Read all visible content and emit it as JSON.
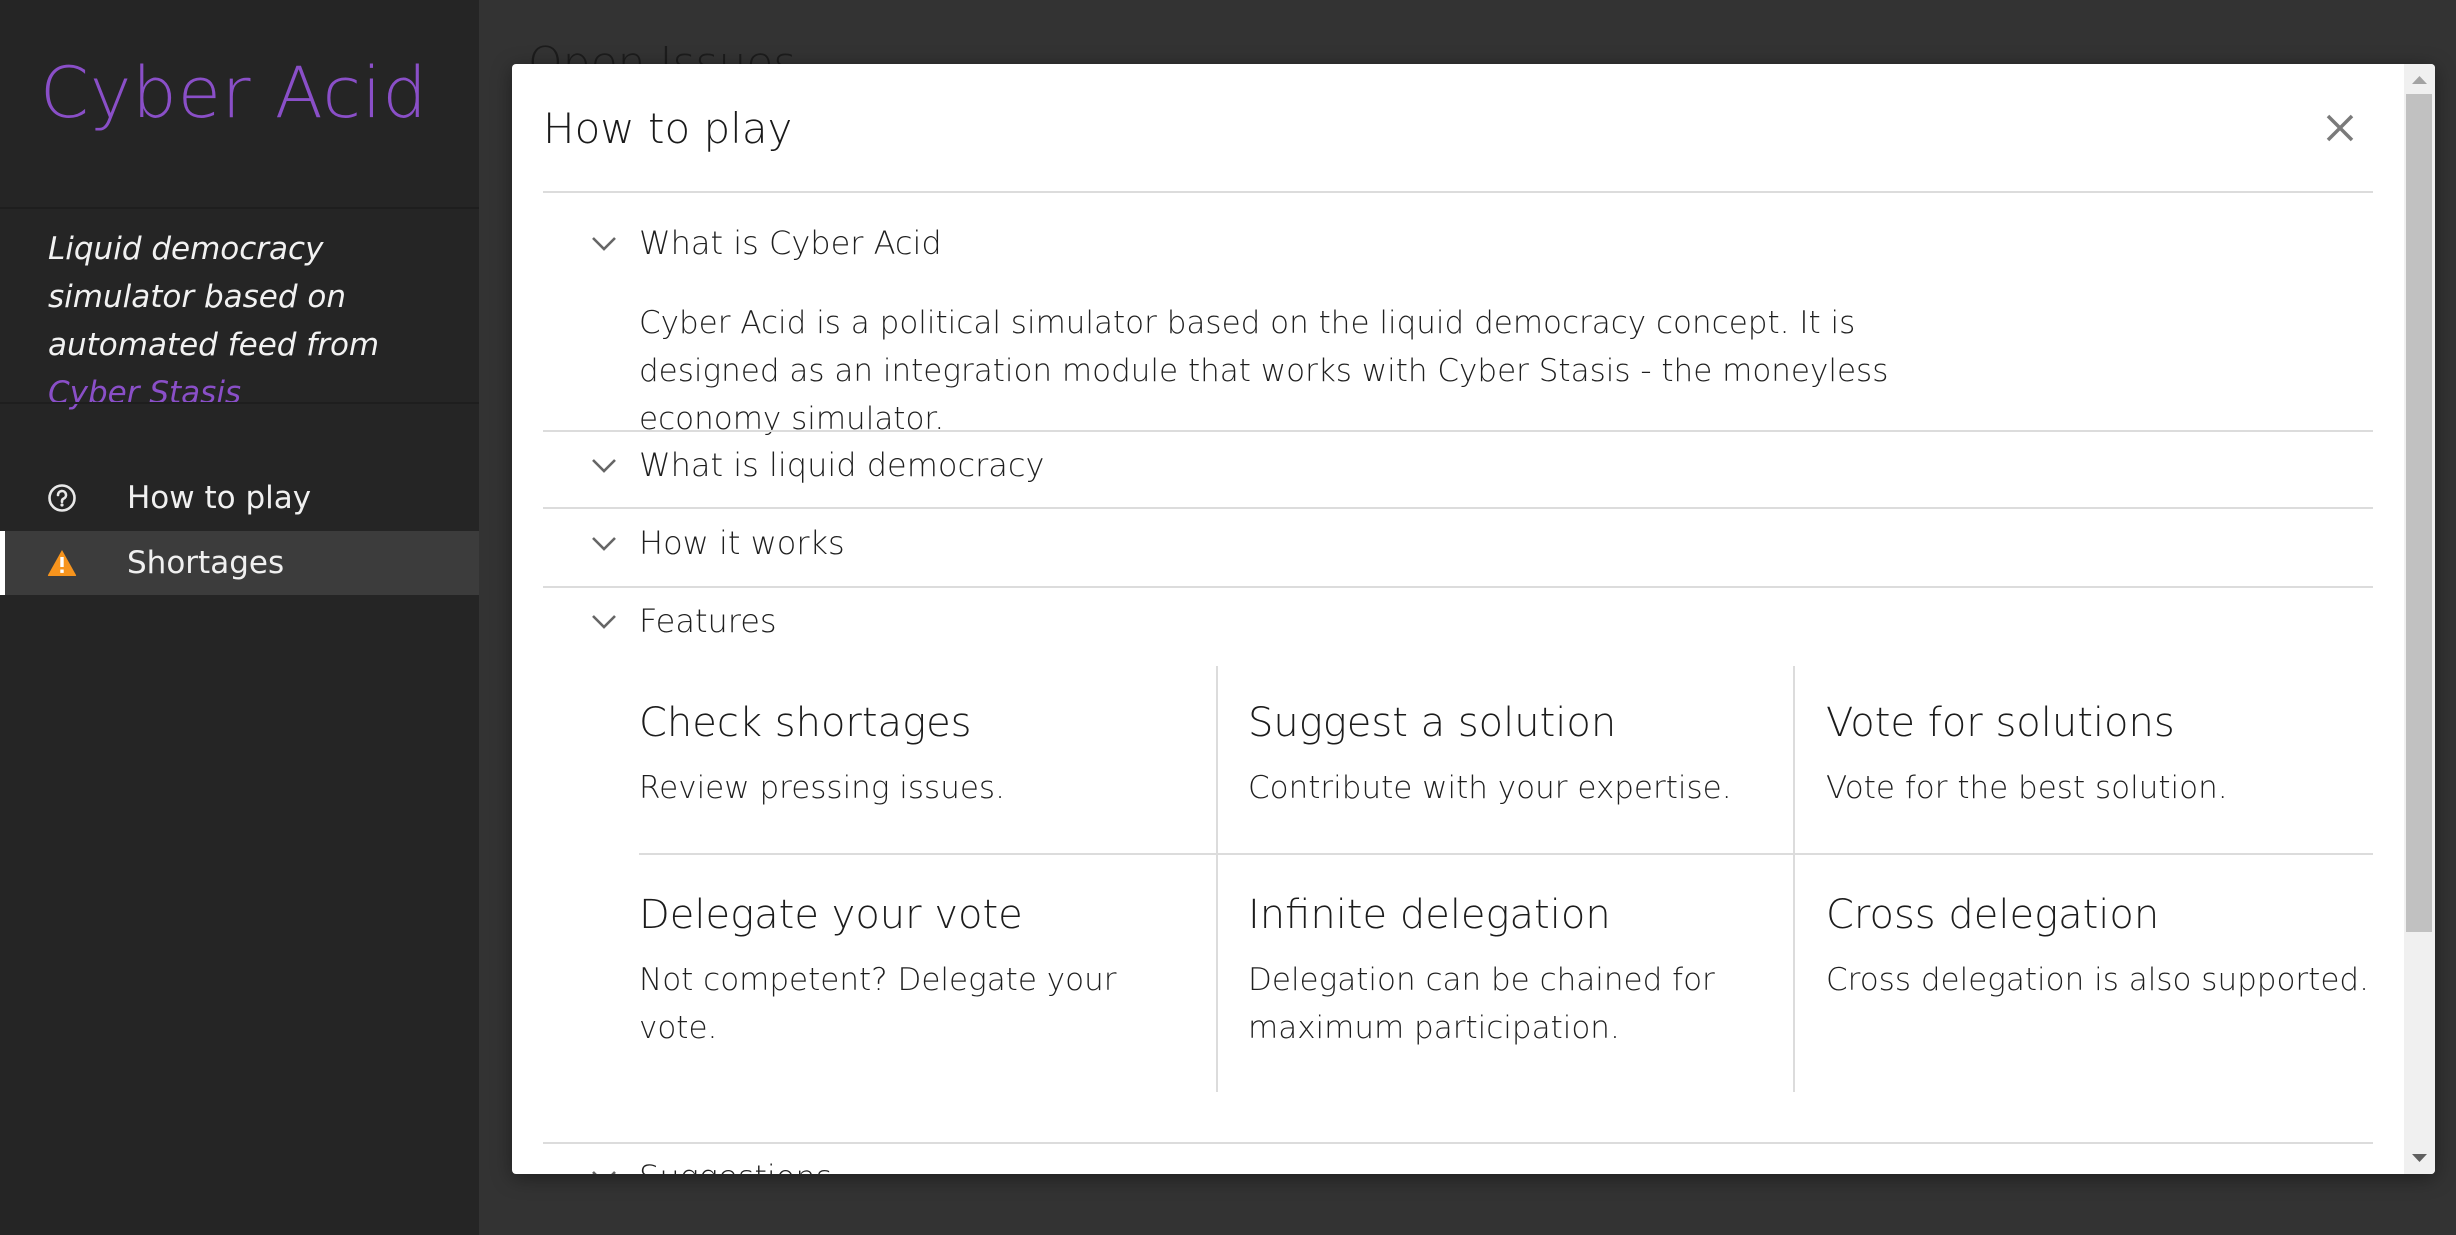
{
  "app": {
    "title": "Cyber Acid",
    "tagline_prefix": "Liquid democracy simulator based on automated feed from ",
    "tagline_link": "Cyber Stasis",
    "accent_color": "#8a4fc8",
    "warning_color": "#f7941d"
  },
  "sidebar": {
    "items": [
      {
        "label": "How to play",
        "icon": "help-circle-icon",
        "active": false
      },
      {
        "label": "Shortages",
        "icon": "warning-icon",
        "active": true
      }
    ]
  },
  "background_page": {
    "title": "Open Issues"
  },
  "modal": {
    "title": "How to play",
    "close_label": "×",
    "sections": [
      {
        "label": "What is Cyber Acid",
        "expanded": true,
        "body": "Cyber Acid is a political simulator based on the liquid democracy concept. It is designed as an integration module that works with Cyber Stasis - the moneyless economy simulator."
      },
      {
        "label": "What is liquid democracy",
        "expanded": false
      },
      {
        "label": "How it works",
        "expanded": false
      },
      {
        "label": "Features",
        "expanded": true,
        "features": [
          {
            "title": "Check shortages",
            "desc": "Review pressing issues."
          },
          {
            "title": "Suggest a solution",
            "desc": "Contribute with your expertise."
          },
          {
            "title": "Vote for solutions",
            "desc": "Vote for the best solution."
          },
          {
            "title": "Delegate your vote",
            "desc": "Not competent? Delegate your vote."
          },
          {
            "title": "Infinite delegation",
            "desc": "Delegation can be chained for maximum participation."
          },
          {
            "title": "Cross delegation",
            "desc": "Cross delegation is also supported."
          }
        ]
      },
      {
        "label": "Suggestions",
        "expanded": false
      }
    ]
  }
}
